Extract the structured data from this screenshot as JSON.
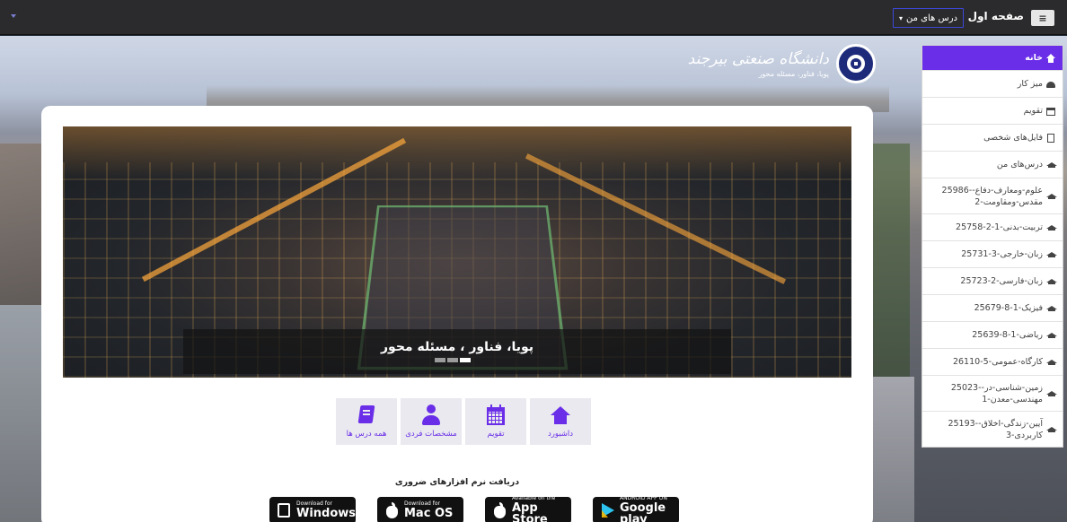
{
  "topbar": {
    "home_label": "صفحه اول",
    "my_courses_label": "درس های من"
  },
  "logo": {
    "name": "دانشگاه صنعتی بیرجند",
    "tagline": "پویا، فناور، مسئله محور"
  },
  "hero": {
    "caption": "پویا، فناور ، مسئله محور"
  },
  "quick_links": [
    {
      "label": "همه درس ها",
      "icon": "book-icon"
    },
    {
      "label": "مشخصات فردی",
      "icon": "user-icon"
    },
    {
      "label": "تقویم",
      "icon": "calendar-icon"
    },
    {
      "label": "داشبورد",
      "icon": "home-icon"
    }
  ],
  "software": {
    "title": "دریافت نرم افزارهای ضروری",
    "stores": [
      {
        "small": "Download for",
        "big": "Windows",
        "icon": "windows-icon"
      },
      {
        "small": "Download for",
        "big": "Mac OS",
        "icon": "apple-icon"
      },
      {
        "small": "Available on the",
        "big": "App Store",
        "icon": "apple-icon"
      },
      {
        "small": "ANDROID APP ON",
        "big": "Google play",
        "icon": "google-play-icon"
      }
    ]
  },
  "sidebar": {
    "items": [
      {
        "label": "خانه",
        "icon": "home-icon",
        "active": true
      },
      {
        "label": "میز کار",
        "icon": "dashboard-icon"
      },
      {
        "label": "تقویم",
        "icon": "calendar-icon"
      },
      {
        "label": "فایل‌های شخصی",
        "icon": "file-icon"
      },
      {
        "label": "درس‌های من",
        "icon": "graduation-cap-icon"
      },
      {
        "label": "25986-علوم-ومعارف-دفاع-مقدس-ومقاومت-2",
        "icon": "graduation-cap-icon"
      },
      {
        "label": "25758-تربیت-بدنی-1-2",
        "icon": "graduation-cap-icon"
      },
      {
        "label": "25731-زبان-خارجی-3",
        "icon": "graduation-cap-icon"
      },
      {
        "label": "25723-زبان-فارسی-2",
        "icon": "graduation-cap-icon"
      },
      {
        "label": "25679-فیزیک-1-8",
        "icon": "graduation-cap-icon"
      },
      {
        "label": "25639-ریاضی-1-8",
        "icon": "graduation-cap-icon"
      },
      {
        "label": "26110-کارگاه-عمومی-5",
        "icon": "graduation-cap-icon"
      },
      {
        "label": "25023-زمین-شناسی-در-مهندسی-معدن-1",
        "icon": "graduation-cap-icon"
      },
      {
        "label": "25193-آیین-زندگی-اخلاق-کاربردی-3",
        "icon": "graduation-cap-icon"
      }
    ]
  },
  "colors": {
    "accent": "#6a2ee8",
    "topbar": "#2b2b2d"
  }
}
